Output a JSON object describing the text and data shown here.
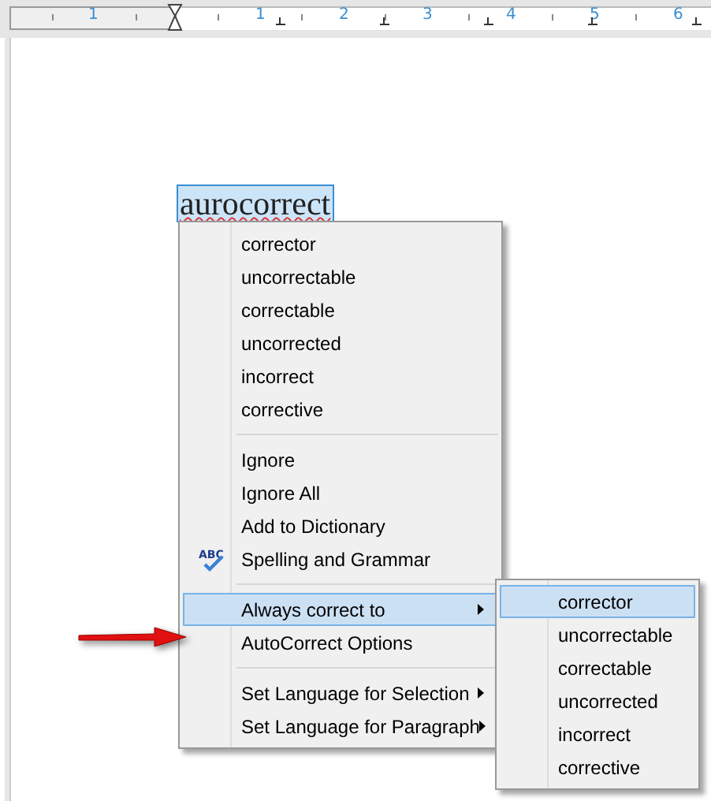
{
  "ruler": {
    "labels": [
      "1",
      "1",
      "2",
      "3",
      "4",
      "5",
      "6"
    ]
  },
  "document": {
    "word": "aurocorrect"
  },
  "context_menu": {
    "items": [
      {
        "kind": "item",
        "label": "corrector",
        "selected": false,
        "submenu": false
      },
      {
        "kind": "item",
        "label": "uncorrectable",
        "selected": false,
        "submenu": false
      },
      {
        "kind": "item",
        "label": "correctable",
        "selected": false,
        "submenu": false
      },
      {
        "kind": "item",
        "label": "uncorrected",
        "selected": false,
        "submenu": false
      },
      {
        "kind": "item",
        "label": "incorrect",
        "selected": false,
        "submenu": false
      },
      {
        "kind": "item",
        "label": "corrective",
        "selected": false,
        "submenu": false
      },
      {
        "kind": "separator"
      },
      {
        "kind": "item",
        "label": "Ignore",
        "selected": false,
        "submenu": false
      },
      {
        "kind": "item",
        "label": "Ignore All",
        "selected": false,
        "submenu": false
      },
      {
        "kind": "item",
        "label": "Add to Dictionary",
        "selected": false,
        "submenu": false
      },
      {
        "kind": "spelling",
        "label": "Spelling and Grammar",
        "icon_text": "ABC",
        "selected": false,
        "submenu": false
      },
      {
        "kind": "separator"
      },
      {
        "kind": "item",
        "label": "Always correct to",
        "selected": true,
        "submenu": true
      },
      {
        "kind": "item",
        "label": "AutoCorrect Options",
        "selected": false,
        "submenu": false
      },
      {
        "kind": "separator"
      },
      {
        "kind": "item",
        "label": "Set Language for Selection",
        "selected": false,
        "submenu": true
      },
      {
        "kind": "item",
        "label": "Set Language for Paragraph",
        "selected": false,
        "submenu": true
      }
    ]
  },
  "submenu": {
    "items": [
      {
        "label": "corrector",
        "selected": true
      },
      {
        "label": "uncorrectable",
        "selected": false
      },
      {
        "label": "correctable",
        "selected": false
      },
      {
        "label": "uncorrected",
        "selected": false
      },
      {
        "label": "incorrect",
        "selected": false
      },
      {
        "label": "corrective",
        "selected": false
      }
    ]
  }
}
